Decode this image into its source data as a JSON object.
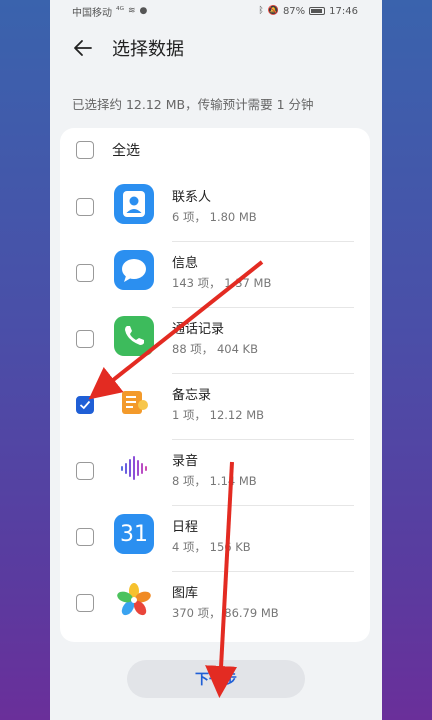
{
  "status_bar": {
    "carrier": "中国移动",
    "signal": "⁴ᴳ",
    "battery_pct": "87%",
    "time": "17:46"
  },
  "header": {
    "title": "选择数据"
  },
  "info": {
    "text": "已选择约 12.12 MB，传输预计需要 1 分钟"
  },
  "select_all": {
    "label": "全选",
    "checked": false
  },
  "items": [
    {
      "name": "联系人",
      "meta": "6 项， 1.80 MB",
      "checked": false,
      "icon": "contacts-icon",
      "color": "#2b8ff0"
    },
    {
      "name": "信息",
      "meta": "143 项， 1.37 MB",
      "checked": false,
      "icon": "messages-icon",
      "color": "#2b8ff0"
    },
    {
      "name": "通话记录",
      "meta": "88 项， 404 KB",
      "checked": false,
      "icon": "phone-icon",
      "color": "#3dbb5c"
    },
    {
      "name": "备忘录",
      "meta": "1 项， 12.12 MB",
      "checked": true,
      "icon": "notepad-icon",
      "color": "#f39a2b"
    },
    {
      "name": "录音",
      "meta": "8 项， 1.14 MB",
      "checked": false,
      "icon": "recorder-icon",
      "color": "#8e54d6"
    },
    {
      "name": "日程",
      "meta": "4 项， 156 KB",
      "checked": false,
      "icon": "calendar-icon",
      "color": "#2b8ff0",
      "icon_text": "31"
    },
    {
      "name": "图库",
      "meta": "370 项， 86.79 MB",
      "checked": false,
      "icon": "gallery-icon",
      "color": "#f0a020"
    }
  ],
  "footer": {
    "next_label": "下一步"
  },
  "colors": {
    "accent": "#1f5fd6",
    "annotation_arrow": "#e32b22"
  }
}
